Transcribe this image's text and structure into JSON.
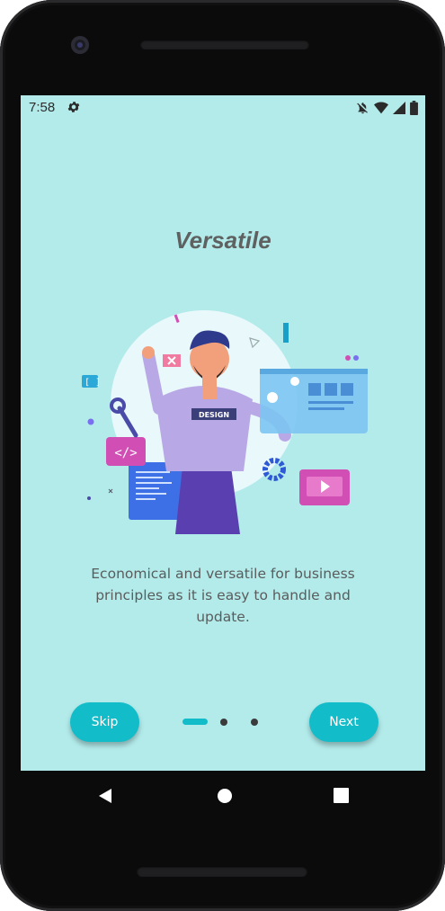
{
  "status_bar": {
    "time": "7:58",
    "icons": [
      "settings-icon",
      "notifications-off-icon",
      "wifi-icon",
      "signal-icon",
      "battery-icon"
    ]
  },
  "onboarding": {
    "title": "Versatile",
    "illustration_badge": "DESIGN",
    "illustration_code_badge": "</>",
    "description": "Economical and versatile for business principles as it is easy to handle and update.",
    "skip_label": "Skip",
    "next_label": "Next",
    "page_count": 3,
    "current_page": 1
  },
  "colors": {
    "screen_background": "#b3ebeb",
    "accent": "#12bcc9",
    "title": "#5f6161",
    "body_text": "#5a5c5c"
  },
  "nav_bar": {
    "icons": [
      "back-icon",
      "home-icon",
      "recents-icon"
    ]
  }
}
